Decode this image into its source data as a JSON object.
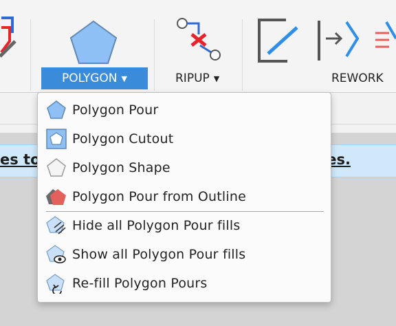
{
  "toolbar": {
    "polygon_label": "POLYGON",
    "ripup_label": "RIPUP",
    "rework_label": "REWORK",
    "caret": "▼"
  },
  "infobar": {
    "text_left": "es to",
    "text_right": "ies."
  },
  "polygon_menu": {
    "items": [
      {
        "label": "Polygon Pour",
        "icon": "polygon-pour-icon"
      },
      {
        "label": "Polygon Cutout",
        "icon": "polygon-cutout-icon"
      },
      {
        "label": "Polygon Shape",
        "icon": "polygon-shape-icon"
      },
      {
        "label": "Polygon Pour from Outline",
        "icon": "polygon-pour-outline-icon"
      },
      {
        "label": "Hide all Polygon Pour fills",
        "icon": "hide-fills-icon"
      },
      {
        "label": "Show all Polygon Pour fills",
        "icon": "show-fills-icon"
      },
      {
        "label": "Re-fill Polygon Pours",
        "icon": "refill-icon"
      }
    ]
  },
  "colors": {
    "accent": "#3a8bd9",
    "polygon_fill": "#8fc0f5",
    "outline_red": "#e3605c",
    "ripup_red": "#e8242b",
    "infobar_bg": "#cfe9fb"
  }
}
